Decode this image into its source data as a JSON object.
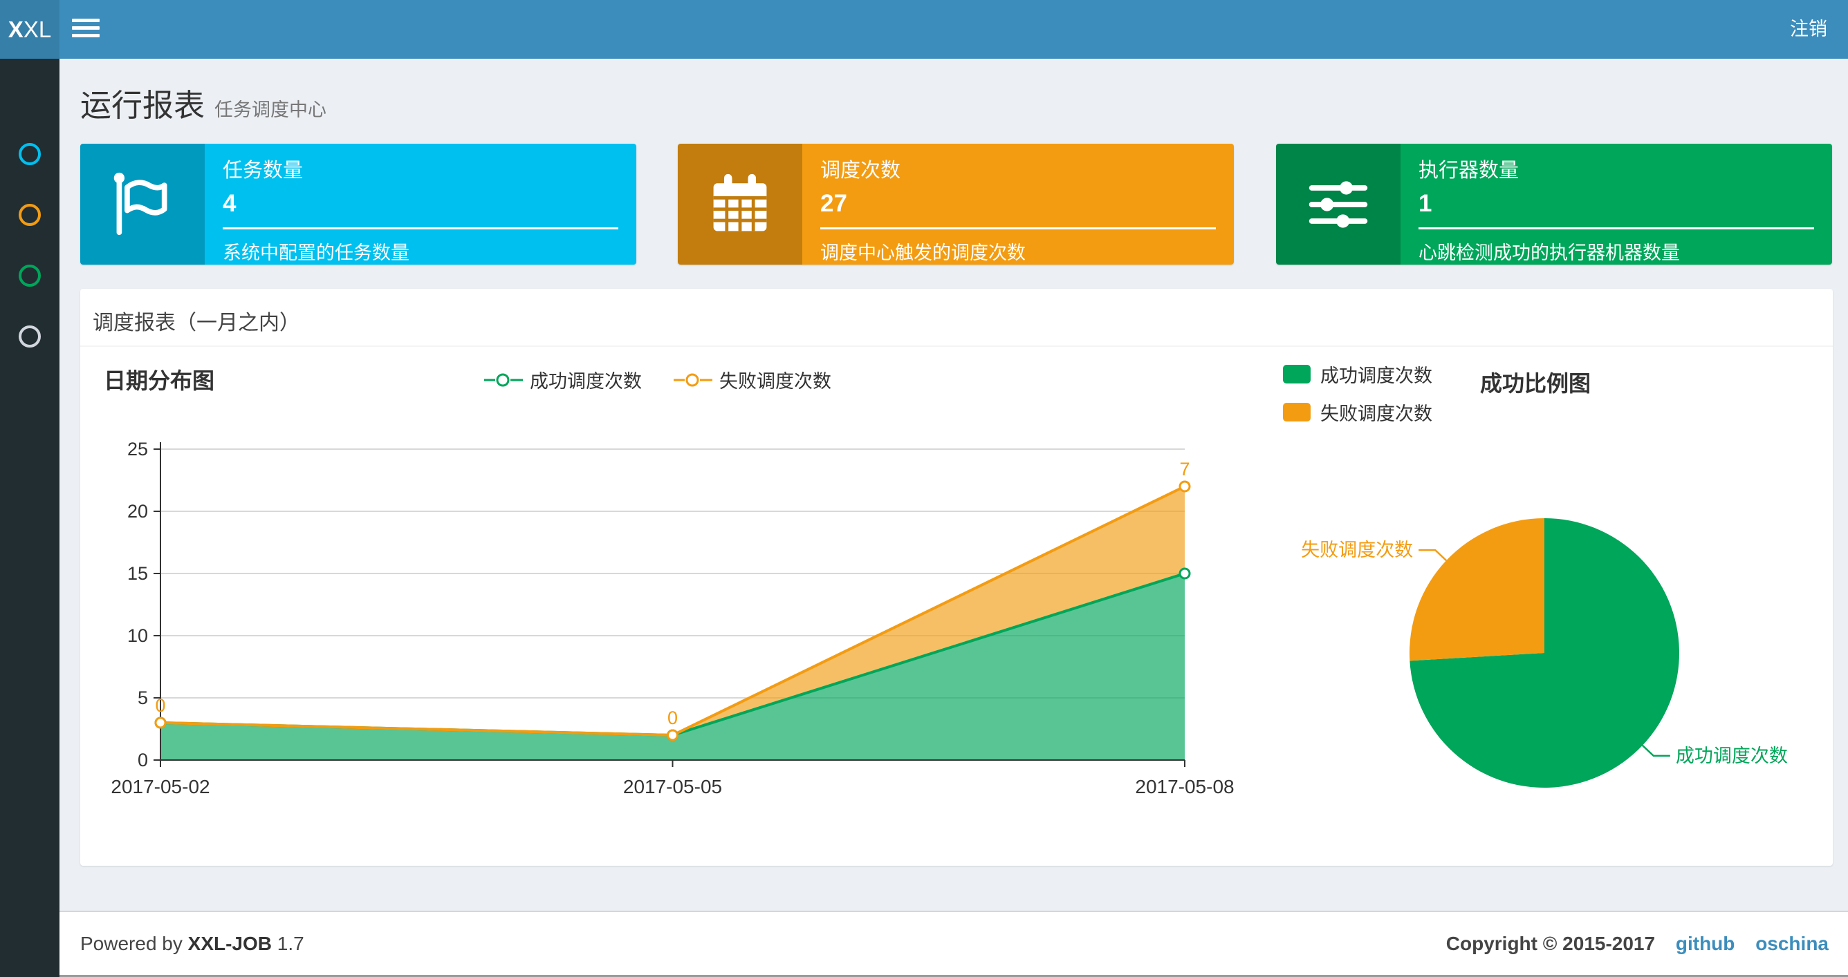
{
  "header": {
    "logo_bold": "X",
    "logo_rest": "XL",
    "logout_label": "注销"
  },
  "sidebar": {
    "items": [
      {
        "id": "menu-report",
        "icon": "circle-outline-icon",
        "color": "#00c0ef"
      },
      {
        "id": "menu-jobs",
        "icon": "circle-outline-icon",
        "color": "#f39c12"
      },
      {
        "id": "menu-log",
        "icon": "circle-outline-icon",
        "color": "#00a65a"
      },
      {
        "id": "menu-executor",
        "icon": "circle-outline-icon",
        "color": "#d2d6de"
      }
    ]
  },
  "page_header": {
    "title": "运行报表",
    "subtitle": "任务调度中心"
  },
  "stat_cards": [
    {
      "label": "任务数量",
      "value": "4",
      "description": "系统中配置的任务数量",
      "color": "#00c0ef",
      "icon_color": "#009abf",
      "icon": "flag-icon"
    },
    {
      "label": "调度次数",
      "value": "27",
      "description": "调度中心触发的调度次数",
      "color": "#f39c12",
      "icon_color": "#c27d0e",
      "icon": "calendar-icon"
    },
    {
      "label": "执行器数量",
      "value": "1",
      "description": "心跳检测成功的执行器机器数量",
      "color": "#00a65a",
      "icon_color": "#008548",
      "icon": "sliders-icon"
    }
  ],
  "panel": {
    "title": "调度报表（一月之内）"
  },
  "chart_data": [
    {
      "type": "area",
      "title": "日期分布图",
      "x": [
        "2017-05-02",
        "2017-05-05",
        "2017-05-08"
      ],
      "series": [
        {
          "name": "成功调度次数",
          "values": [
            3,
            2,
            15
          ],
          "color": "#00a65a"
        },
        {
          "name": "失败调度次数",
          "values": [
            0,
            0,
            7
          ],
          "color": "#f39c12",
          "point_labels": [
            "0",
            "0",
            "7"
          ]
        }
      ],
      "stacked": true,
      "ylim": [
        0,
        25
      ],
      "yticks": [
        0,
        5,
        10,
        15,
        20,
        25
      ],
      "grid": true,
      "grid_color": "#cccccc",
      "axis_color": "#333333",
      "legend_position": "top-center",
      "area_opacity": 0.65
    },
    {
      "type": "pie",
      "title": "成功比例图",
      "labels": [
        "成功调度次数",
        "失败调度次数"
      ],
      "values": [
        20,
        7
      ],
      "colors": [
        "#00a65a",
        "#f39c12"
      ],
      "legend_position": "top-left",
      "callout_labels": true
    }
  ],
  "footer": {
    "powered_prefix": "Powered by",
    "product": "XXL-JOB",
    "version": "1.7",
    "copyright": "Copyright © 2015-2017",
    "links": [
      "github",
      "oschina"
    ],
    "link_color": "#3c8dbc"
  },
  "colors": {
    "header": "#3c8dbc",
    "logo_bg": "#367fa9",
    "sidebar_bg": "#222d32",
    "content_bg": "#ecf0f5",
    "box_bg": "#ffffff"
  }
}
